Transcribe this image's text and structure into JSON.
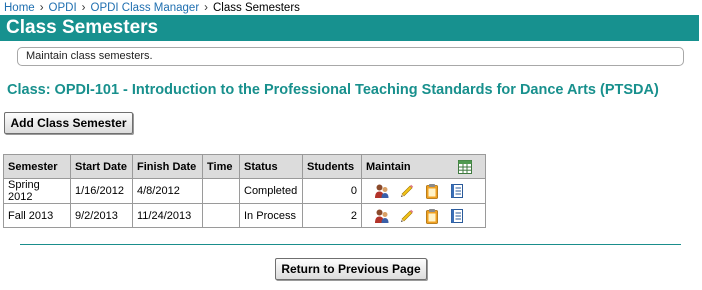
{
  "breadcrumb": {
    "items": [
      "Home",
      "OPDI",
      "OPDI Class Manager"
    ],
    "current": "Class Semesters",
    "separator": "›"
  },
  "page": {
    "title": "Class Semesters",
    "description": "Maintain class semesters.",
    "class_heading": "Class: OPDI-101 - Introduction to the Professional Teaching Standards for Dance Arts (PTSDA)",
    "add_button": "Add Class Semester",
    "return_button": "Return to Previous Page"
  },
  "table": {
    "columns": [
      "Semester",
      "Start Date",
      "Finish Date",
      "Time",
      "Status",
      "Students",
      "Maintain"
    ],
    "header_icon": "spreadsheet-icon",
    "rows": [
      {
        "semester": "Spring 2012",
        "start": "1/16/2012",
        "finish": "4/8/2012",
        "time": "",
        "status": "Completed",
        "students": "0"
      },
      {
        "semester": "Fall 2013",
        "start": "9/2/2013",
        "finish": "11/24/2013",
        "time": "",
        "status": "In Process",
        "students": "2"
      }
    ],
    "row_icons": [
      "students-icon",
      "edit-pencil-icon",
      "clipboard-icon",
      "roster-icon"
    ]
  },
  "colors": {
    "accent": "#17918f",
    "link": "#1f6fb0",
    "header_bg": "#dcdcdc"
  }
}
